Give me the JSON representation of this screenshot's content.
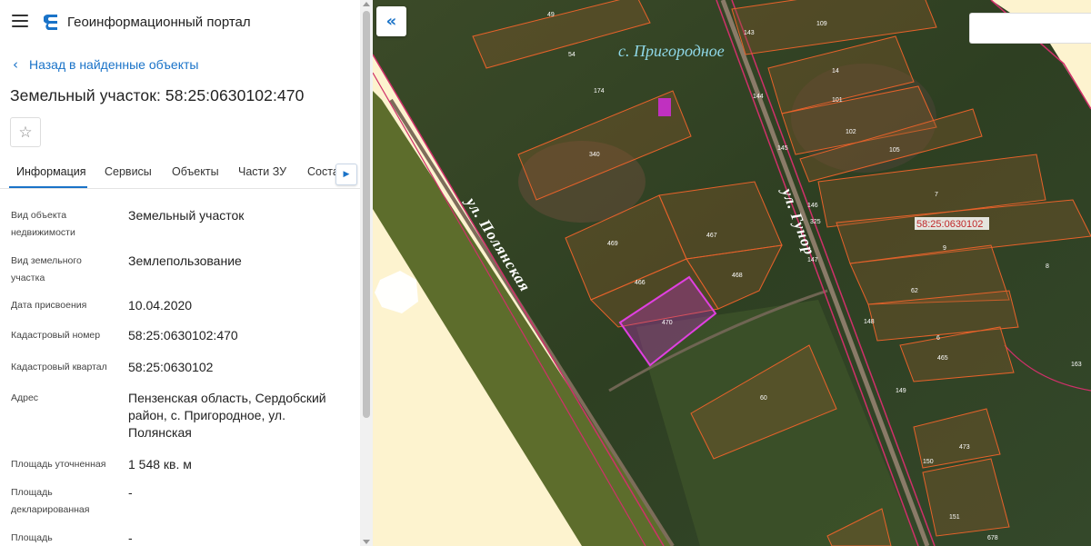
{
  "app": {
    "title": "Геоинформационный портал",
    "menu_icon": "hamburger-menu-icon",
    "logo_icon": "portal-logo-icon"
  },
  "nav": {
    "back_label": "Назад в найденные объекты",
    "back_icon": "chevron-left-icon"
  },
  "object": {
    "title": "Земельный участок: 58:25:0630102:470",
    "favorite_icon": "star-icon"
  },
  "tabs": [
    {
      "label": "Информация",
      "active": true
    },
    {
      "label": "Сервисы"
    },
    {
      "label": "Объекты"
    },
    {
      "label": "Части ЗУ"
    },
    {
      "label": "Соста"
    }
  ],
  "tabs_scroll_icon": "chevron-right-icon",
  "details": [
    {
      "label": "Вид объекта недвижимости",
      "value": "Земельный участок"
    },
    {
      "label": "Вид земельного участка",
      "value": "Землепользование"
    },
    {
      "label": "Дата присвоения",
      "value": "10.04.2020"
    },
    {
      "label": "Кадастровый номер",
      "value": "58:25:0630102:470"
    },
    {
      "label": "Кадастровый квартал",
      "value": "58:25:0630102"
    },
    {
      "label": "Адрес",
      "value": "Пензенская область, Сердобский район, с. Пригородное, ул. Полянская"
    },
    {
      "label": "Площадь уточненная",
      "value": "1 548 кв. м"
    },
    {
      "label": "Площадь декларированная",
      "value": "-"
    },
    {
      "label": "Площадь",
      "value": "-"
    }
  ],
  "map": {
    "collapse_icon": "double-chevron-left-icon",
    "village_label": "с. Пригородное",
    "street_1": "ул. Полянская",
    "street_2": "ул. Гунор",
    "quarter_label": "58:25:0630102",
    "colors": {
      "parcel_line": "#e8622a",
      "boundary_line": "#d0306a",
      "selected_parcel": "#c030c0",
      "background": "#fdf3cf",
      "accent": "#1a73c8"
    },
    "parcel_numbers": [
      "49",
      "54",
      "174",
      "340",
      "469",
      "467",
      "466",
      "468",
      "470",
      "60",
      "143",
      "109",
      "14",
      "101",
      "144",
      "102",
      "145",
      "105",
      "7",
      "146",
      "325",
      "9",
      "147",
      "148",
      "62",
      "6",
      "465",
      "149",
      "150",
      "473",
      "151",
      "678",
      "163",
      "8"
    ]
  }
}
